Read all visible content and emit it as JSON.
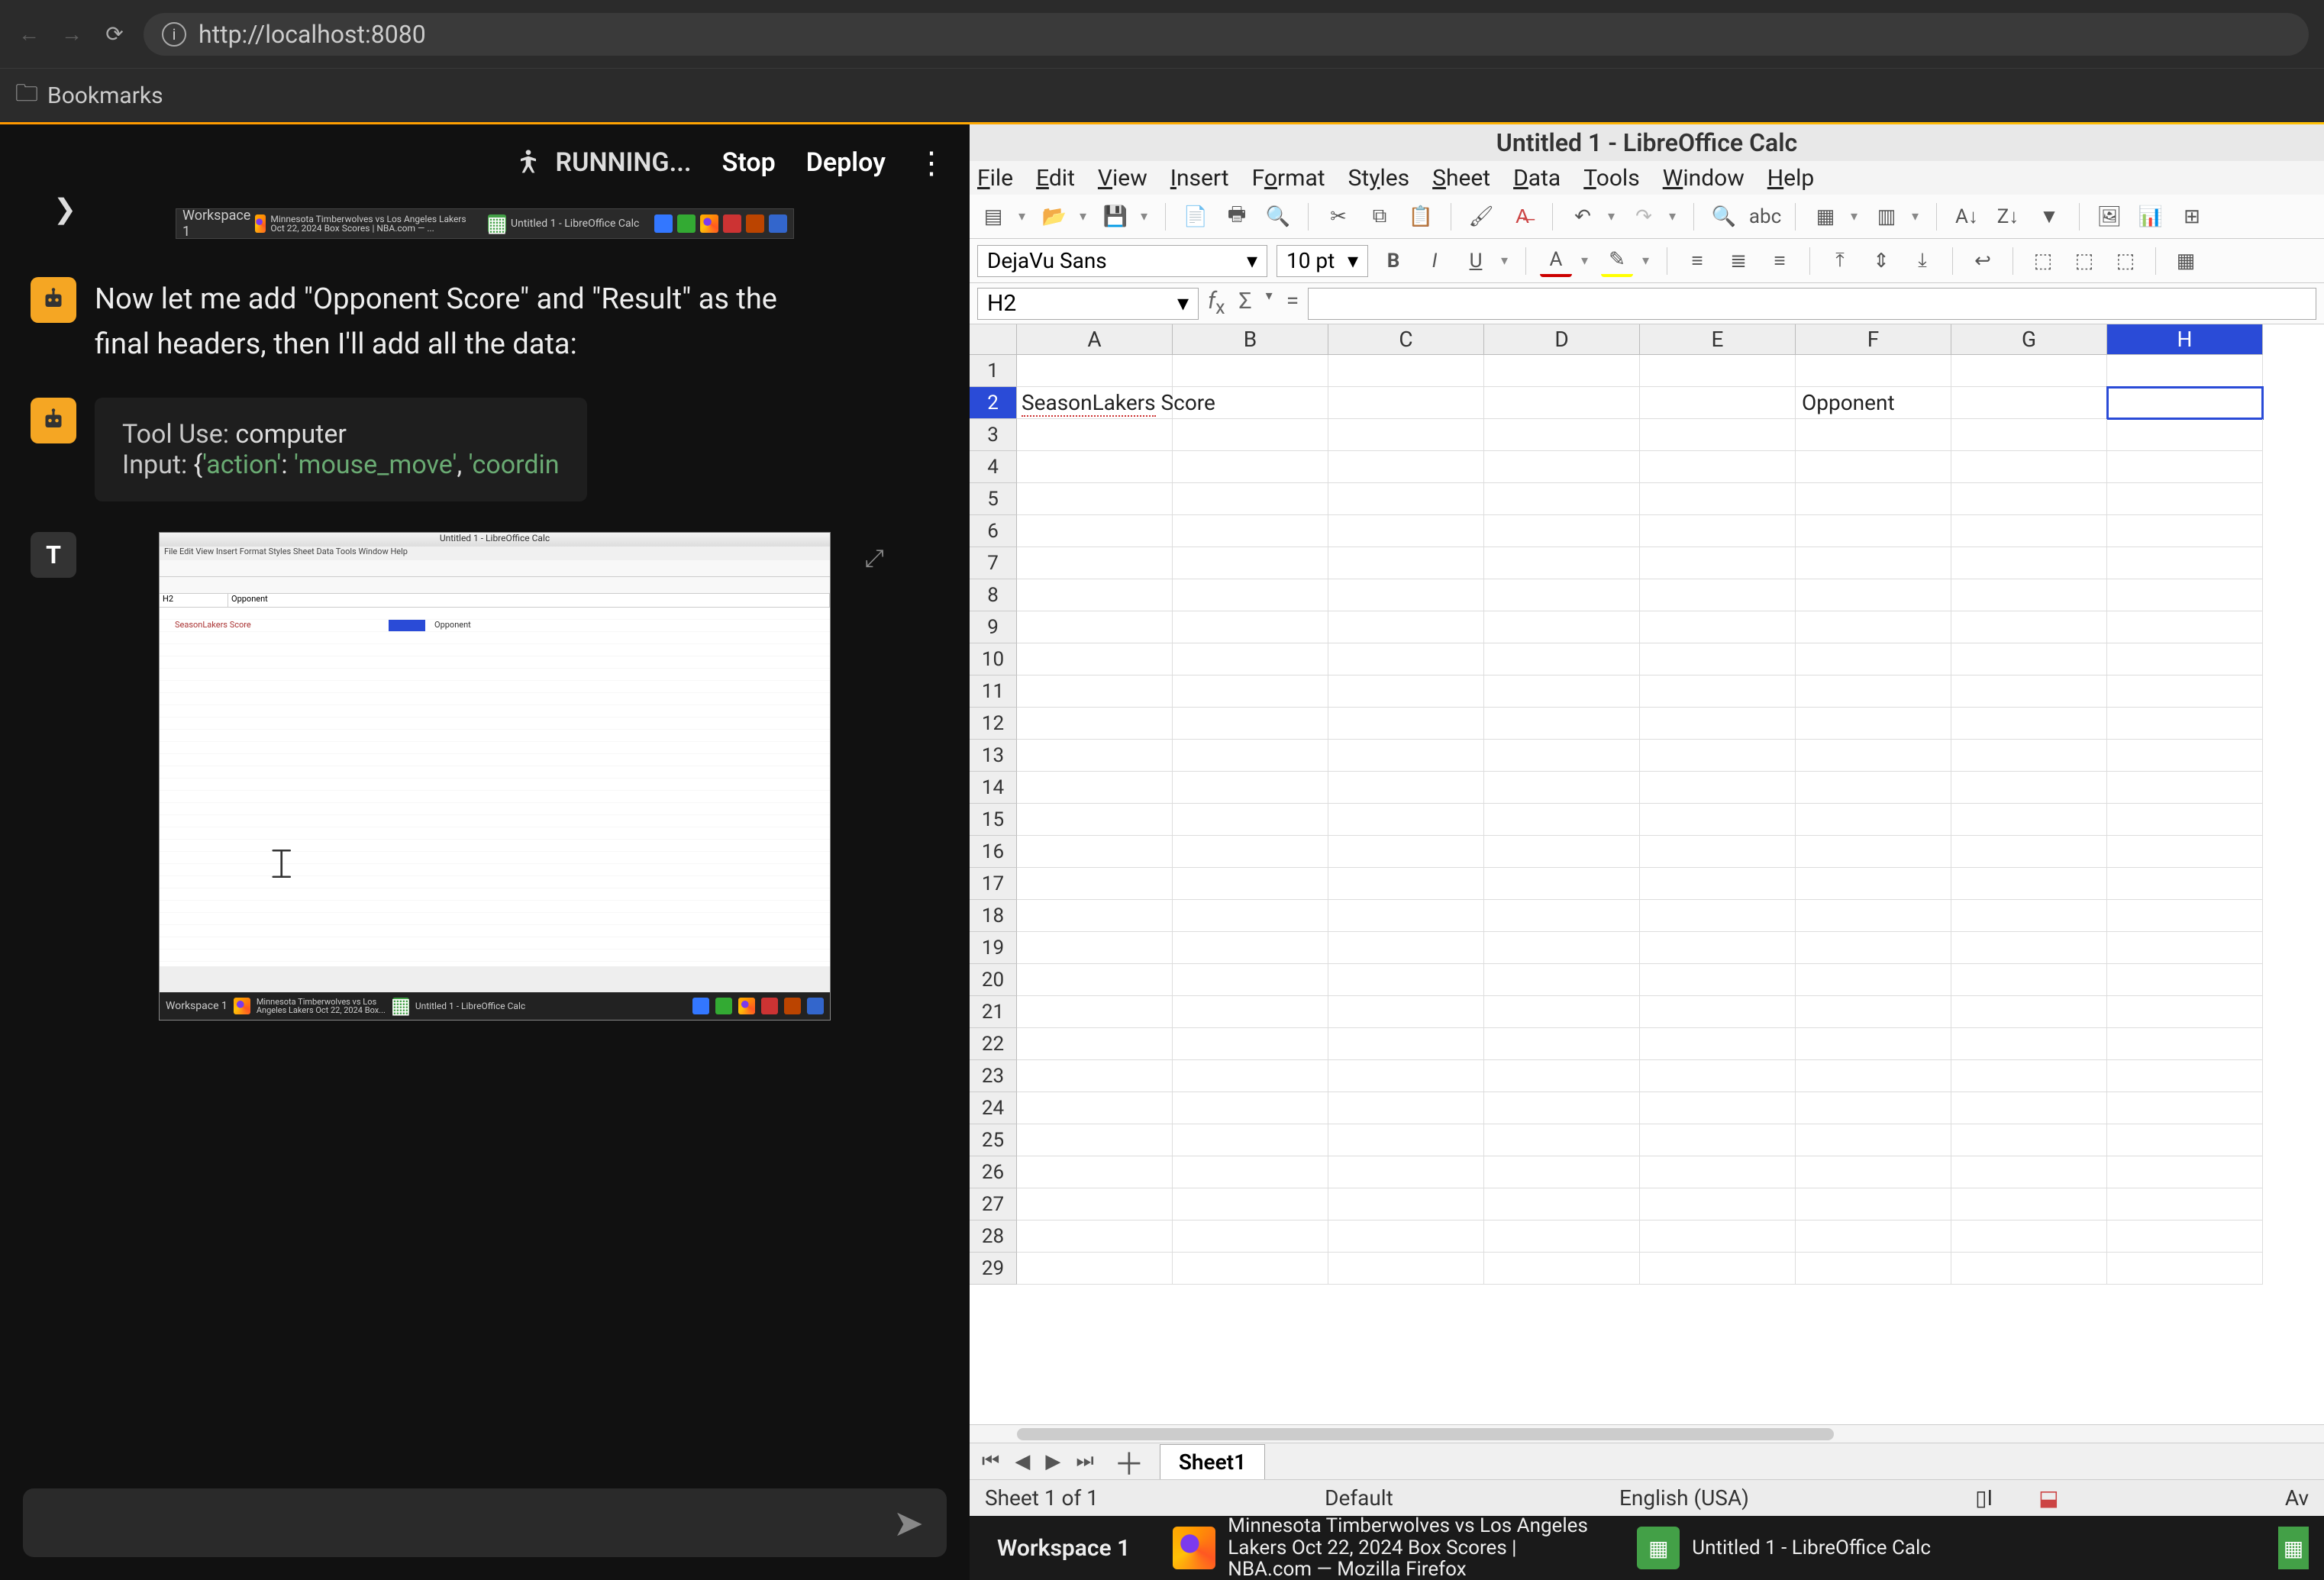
{
  "browser": {
    "url": "http://localhost:8080",
    "bookmarks_label": "Bookmarks"
  },
  "left_header": {
    "running": "RUNNING...",
    "stop": "Stop",
    "deploy": "Deploy"
  },
  "mini_taskbar": {
    "workspace": "Workspace 1",
    "firefox_title": "Minnesota Timberwolves vs Los Angeles Lakers Oct 22, 2024 Box Scores | NBA.com — ...",
    "calc_title": "Untitled 1 - LibreOffice Calc"
  },
  "messages": {
    "assistant_text": "Now let me add \"Opponent Score\" and \"Result\" as the final headers, then I'll add all the data:",
    "tool_label": "Tool Use: ",
    "tool_name": "computer",
    "input_label": "Input: ",
    "input_json_preview": "{'action': 'mouse_move', 'coordin"
  },
  "thumb": {
    "title": "Untitled 1 - LibreOffice Calc",
    "name_box": "H2",
    "r2text": "SeasonLakers Score",
    "opp": "Opponent",
    "workspace": "Workspace 1"
  },
  "calc": {
    "title": "Untitled 1 - LibreOffice Calc",
    "menu": [
      "File",
      "Edit",
      "View",
      "Insert",
      "Format",
      "Styles",
      "Sheet",
      "Data",
      "Tools",
      "Window",
      "Help"
    ],
    "font_name": "DejaVu Sans",
    "font_size": "10 pt",
    "name_box": "H2",
    "columns": [
      "A",
      "B",
      "C",
      "D",
      "E",
      "F",
      "G",
      "H"
    ],
    "row_count": 29,
    "cells": {
      "A2": "SeasonLakers Score",
      "F2": "Opponent"
    },
    "active_cell": "H2",
    "sheet_tab": "Sheet1",
    "status_sheet": "Sheet 1 of 1",
    "status_style": "Default",
    "status_lang": "English (USA)",
    "status_avg": "Av"
  },
  "os_taskbar": {
    "workspace": "Workspace 1",
    "firefox_title": "Minnesota Timberwolves vs Los Angeles Lakers Oct 22, 2024 Box Scores | NBA.com — Mozilla Firefox",
    "calc_title": "Untitled 1 - LibreOffice Calc"
  },
  "tool_avatar_letter": "T"
}
